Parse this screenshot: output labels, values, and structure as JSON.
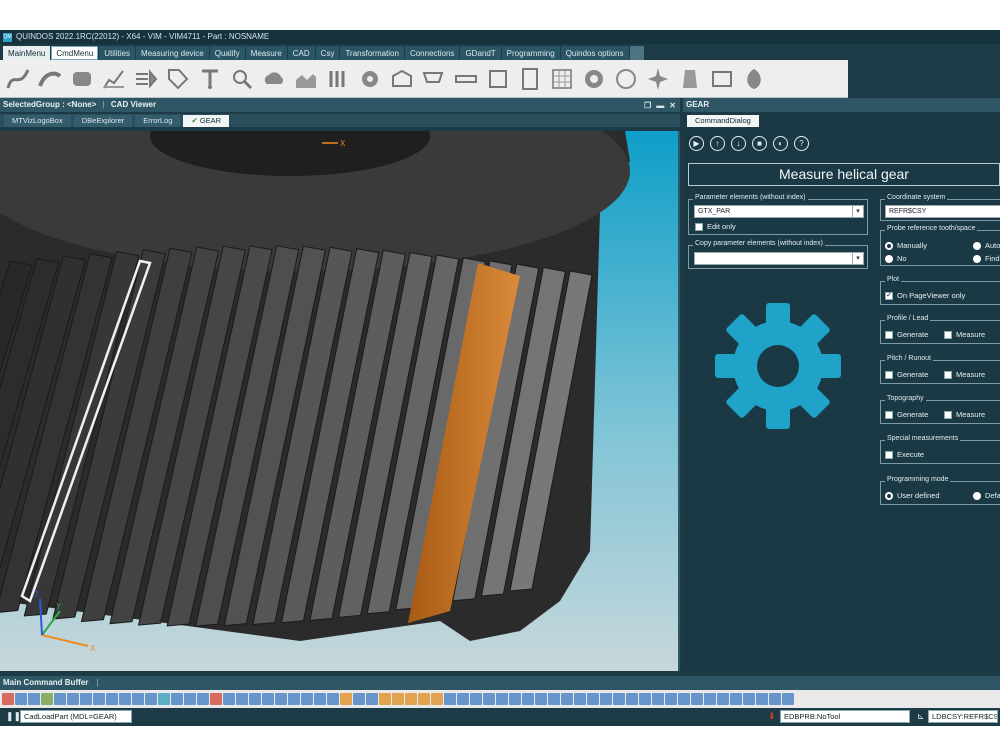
{
  "window": {
    "title": "QUINDOS 2022.1RC(22012) - X64 - VIM - VIM4711 - Part : NOSNAME",
    "logo_text": "QM"
  },
  "menu": {
    "tabs": [
      "MainMenu",
      "CmdMenu",
      "Utilities",
      "Measuring device",
      "Qualify",
      "Measure",
      "CAD",
      "Csy",
      "Transformation",
      "Connections",
      "GDandT",
      "Programming",
      "Quindos options"
    ]
  },
  "ribbon": {
    "icons": [
      "curve-icon",
      "spline-icon",
      "pipes-icon",
      "chart-icon",
      "arrow-bars-icon",
      "tag-icon",
      "probe-icon",
      "magnifier-icon",
      "cloud-icon",
      "surface-icon",
      "bracket-icon",
      "gear-icon",
      "box-icon",
      "cart-icon",
      "ruler-icon",
      "frame-icon",
      "document-icon",
      "grid-icon",
      "gear-large-icon",
      "circle-icon",
      "star-gear-icon",
      "cylinder-icon",
      "pipe-icon",
      "leaf-icon"
    ]
  },
  "left_pane": {
    "header": "SelectedGroup : <None>",
    "header_view": "CAD Viewer",
    "tabs": [
      "MTVizLogoBox",
      "DBeExplorer",
      "ErrorLog",
      "GEAR"
    ],
    "active_tab": "GEAR",
    "axis_labels": {
      "x": "X",
      "y": "Y",
      "z": "Z"
    }
  },
  "right_pane": {
    "header": "GEAR",
    "tab": "CommandDialog",
    "title": "Measure helical gear",
    "toolbar_icons": [
      "play-icon",
      "upload-icon",
      "download-icon",
      "stop-icon",
      "contrast-icon",
      "help-icon"
    ],
    "param_group": {
      "label": "Parameter elements (without index)",
      "value": "GTX_PAR",
      "edit_only": "Edit only"
    },
    "copy_group": {
      "label": "Copy parameter elements (without index)",
      "value": ""
    },
    "csy_group": {
      "label": "Coordinate system",
      "value": "REFR$CSY"
    },
    "probe_group": {
      "label": "Probe reference tooth/space",
      "manually": "Manually",
      "auto": "Auto",
      "no": "No",
      "find": "Find"
    },
    "plot_group": {
      "label": "Plot",
      "option": "On PageViewer only"
    },
    "profile_group": {
      "label": "Profile / Lead",
      "generate": "Generate",
      "measure": "Measure"
    },
    "pitch_group": {
      "label": "Pitch / Runout",
      "generate": "Generate",
      "measure": "Measure"
    },
    "topo_group": {
      "label": "Topography",
      "generate": "Generate",
      "measure": "Measure"
    },
    "special_group": {
      "label": "Special measurements",
      "execute": "Execute"
    },
    "prog_group": {
      "label": "Programming mode",
      "user": "User defined",
      "default": "Defa"
    }
  },
  "bottom": {
    "header": "Main Command Buffer",
    "command": "CadLoadPart    (MDL=GEAR)",
    "probe": "EDBPRB:NoTool",
    "csy": "LDBCSY:REFR$CSY"
  },
  "colors": {
    "accent": "#1fa3c9",
    "bg": "#1a3944",
    "orange": "#c9721f"
  }
}
